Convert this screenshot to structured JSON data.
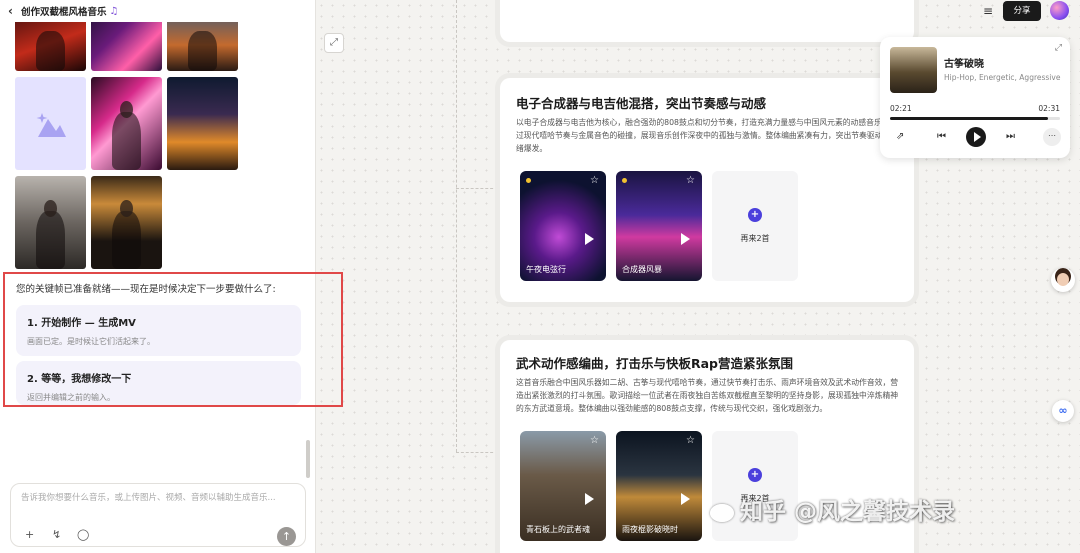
{
  "header": {
    "title": "创作双截棍风格音乐",
    "back_icon": "chevron-left-icon",
    "note_icon": "music-note-icon",
    "share_label": "分享"
  },
  "chat": {
    "message": "您的关键帧已准备就绪——现在是时候决定下一步要做什么了:",
    "options": [
      {
        "title": "1. 开始制作 — 生成MV",
        "subtitle": "画面已定。是时候让它们活起来了。"
      },
      {
        "title": "2. 等等，我想修改一下",
        "subtitle": "返回并编辑之前的输入。"
      }
    ],
    "input_placeholder": "告诉我你想要什么音乐，或上传图片、视频、音频以辅助生成音乐..."
  },
  "cards": [
    {
      "title": "电子合成器与电吉他混搭，突出节奏感与动感",
      "description": "以电子合成器与电吉他为核心，融合强劲的808鼓点和切分节奏，打造充满力量感与中国风元素的动感音乐。通过现代嘻哈节奏与金属音色的碰撞，展现音乐创作深夜中的孤独与激情。整体编曲紧凑有力，突出节奏驱动与情绪爆发。",
      "songs": [
        {
          "label": "午夜电弦行"
        },
        {
          "label": "合成器风暴"
        }
      ],
      "more_label": "再来2首"
    },
    {
      "title": "武术动作感编曲，打击乐与快板Rap营造紧张氛围",
      "description": "这首音乐融合中国风乐器如二胡、古筝与现代嘻哈节奏，通过快节奏打击乐、雨声环境音效及武术动作音效，营造出紧张激烈的打斗氛围。歌词描绘一位武者在雨夜独自苦练双截棍直至黎明的坚持身影，展现孤独中淬炼精神的东方武道意境。整体编曲以强劲能感的808鼓点支撑，传统与现代交织，强化戏剧张力。",
      "songs": [
        {
          "label": "青石板上的武者魂"
        },
        {
          "label": "雨夜棍影破晓时"
        }
      ],
      "more_label": "再来2首"
    }
  ],
  "player": {
    "title": "古筝破晓",
    "tags": "Hip-Hop, Energetic, Aggressive",
    "current_time": "02:21",
    "total_time": "02:31",
    "progress": 0.93
  },
  "watermark": "知乎 @风之馨技术录"
}
